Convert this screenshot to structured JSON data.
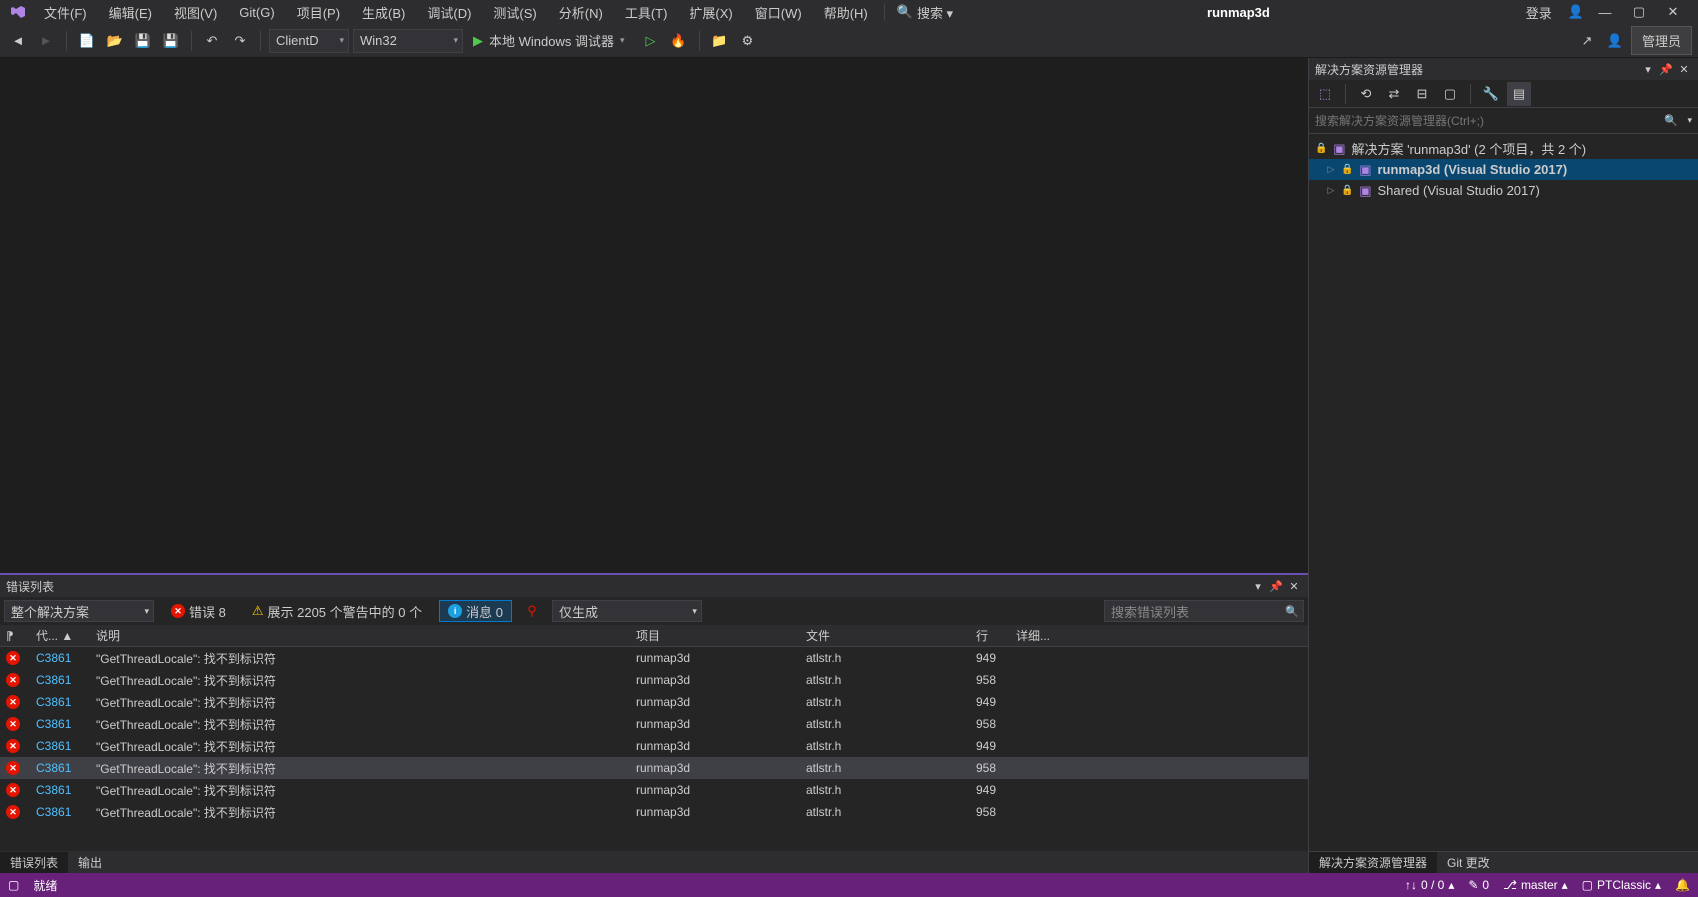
{
  "title": "runmap3d",
  "menu": {
    "file": "文件(F)",
    "edit": "编辑(E)",
    "view": "视图(V)",
    "git": "Git(G)",
    "project": "项目(P)",
    "build": "生成(B)",
    "debug": "调试(D)",
    "test": "测试(S)",
    "analyze": "分析(N)",
    "tools": "工具(T)",
    "extensions": "扩展(X)",
    "window": "窗口(W)",
    "help": "帮助(H)",
    "search": "搜索 ▾"
  },
  "login": "登录",
  "toolbar": {
    "config": "ClientD",
    "platform": "Win32",
    "debugger": "本地 Windows 调试器",
    "admin": "管理员"
  },
  "solution": {
    "title": "解决方案资源管理器",
    "search_placeholder": "搜索解决方案资源管理器(Ctrl+;)",
    "root": "解决方案 'runmap3d' (2 个项目，共 2 个)",
    "proj1": "runmap3d (Visual Studio 2017)",
    "proj2": "Shared (Visual Studio 2017)",
    "tab_sol": "解决方案资源管理器",
    "tab_git": "Git 更改"
  },
  "errlist": {
    "title": "错误列表",
    "scope": "整个解决方案",
    "err_label": "错误 8",
    "warn_label": "展示 2205 个警告中的 0 个",
    "info_label": "消息 0",
    "build_filter": "仅生成",
    "search_placeholder": "搜索错误列表",
    "cols": {
      "code": "代...",
      "desc": "说明",
      "proj": "项目",
      "file": "文件",
      "line": "行",
      "detail": "详细..."
    },
    "rows": [
      {
        "code": "C3861",
        "desc": "\"GetThreadLocale\": 找不到标识符",
        "proj": "runmap3d",
        "file": "atlstr.h",
        "line": "949"
      },
      {
        "code": "C3861",
        "desc": "\"GetThreadLocale\": 找不到标识符",
        "proj": "runmap3d",
        "file": "atlstr.h",
        "line": "958"
      },
      {
        "code": "C3861",
        "desc": "\"GetThreadLocale\": 找不到标识符",
        "proj": "runmap3d",
        "file": "atlstr.h",
        "line": "949"
      },
      {
        "code": "C3861",
        "desc": "\"GetThreadLocale\": 找不到标识符",
        "proj": "runmap3d",
        "file": "atlstr.h",
        "line": "958"
      },
      {
        "code": "C3861",
        "desc": "\"GetThreadLocale\": 找不到标识符",
        "proj": "runmap3d",
        "file": "atlstr.h",
        "line": "949"
      },
      {
        "code": "C3861",
        "desc": "\"GetThreadLocale\": 找不到标识符",
        "proj": "runmap3d",
        "file": "atlstr.h",
        "line": "958",
        "selected": true
      },
      {
        "code": "C3861",
        "desc": "\"GetThreadLocale\": 找不到标识符",
        "proj": "runmap3d",
        "file": "atlstr.h",
        "line": "949"
      },
      {
        "code": "C3861",
        "desc": "\"GetThreadLocale\": 找不到标识符",
        "proj": "runmap3d",
        "file": "atlstr.h",
        "line": "958"
      }
    ],
    "tab_err": "错误列表",
    "tab_out": "输出"
  },
  "status": {
    "ready": "就绪",
    "updown": "0 / 0",
    "pencil": "0",
    "branch": "master",
    "repo": "PTClassic"
  }
}
